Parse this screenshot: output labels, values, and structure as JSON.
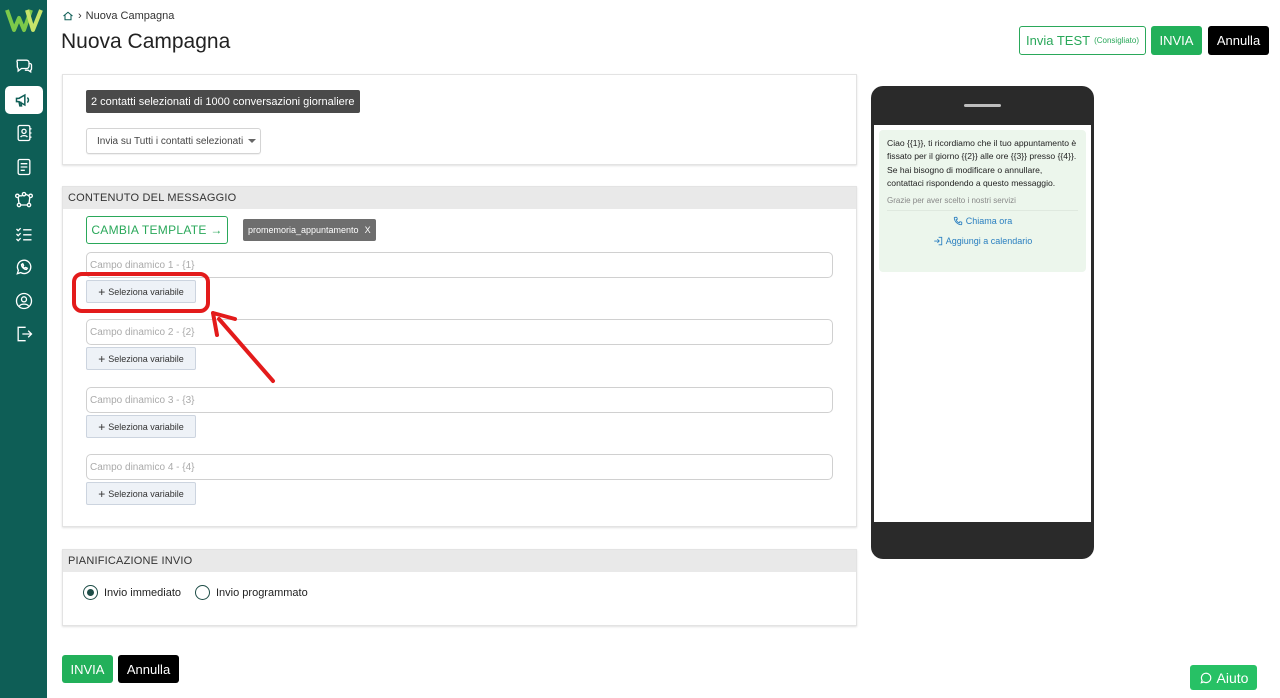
{
  "breadcrumb": {
    "current": "Nuova Campagna"
  },
  "header": {
    "title": "Nuova Campagna",
    "test_label": "Invia TEST",
    "test_hint": "(Consigliato)",
    "send_label": "INVIA",
    "cancel_label": "Annulla"
  },
  "recipients": {
    "selected_text": "2 contatti selezionati di 1000 conversazioni giornaliere",
    "send_mode_value": "Invia su Tutti i contatti selezionati"
  },
  "message": {
    "section_title": "CONTENUTO DEL MESSAGGIO",
    "change_template_label": "CAMBIA TEMPLATE →",
    "template_name": "promemoria_appuntamento",
    "template_remove": "X",
    "fields": [
      {
        "placeholder": "Campo dinamico 1 - {1}",
        "button": "Seleziona variabile"
      },
      {
        "placeholder": "Campo dinamico 2 - {2}",
        "button": "Seleziona variabile"
      },
      {
        "placeholder": "Campo dinamico 3 - {3}",
        "button": "Seleziona variabile"
      },
      {
        "placeholder": "Campo dinamico 4 - {4}",
        "button": "Seleziona variabile"
      }
    ]
  },
  "schedule": {
    "section_title": "PIANIFICAZIONE INVIO",
    "option_immediate": "Invio immediato",
    "option_scheduled": "Invio programmato",
    "selected": "immediate"
  },
  "footer": {
    "send_label": "INVIA",
    "cancel_label": "Annulla"
  },
  "preview": {
    "body": "Ciao {{1}}, ti ricordiamo che il tuo appuntamento è fissato per il giorno {{2}} alle ore {{3}} presso {{4}}.\nSe hai bisogno di modificare o annullare, contattaci rispondendo a questo messaggio.",
    "footer": "Grazie per aver scelto i nostri servizi",
    "action_call": "Chiama ora",
    "action_calendar": "Aggiungi a calendario"
  },
  "help": {
    "label": "Aiuto"
  },
  "colors": {
    "sidebar": "#0e5e56",
    "accent_green": "#22b05a",
    "annotation_red": "#e31b1b",
    "link_blue": "#2a7fc0"
  }
}
